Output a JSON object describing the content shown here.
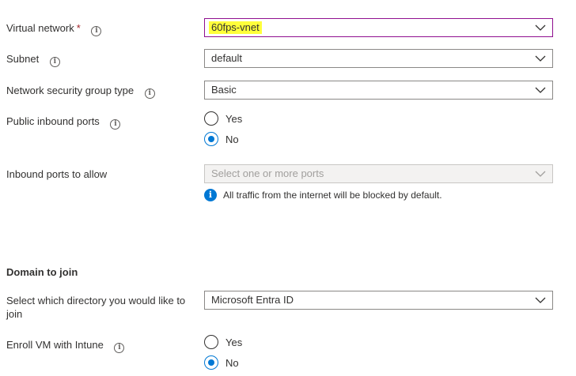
{
  "virtual_network": {
    "label": "Virtual network",
    "required_mark": "*",
    "value": "60fps-vnet"
  },
  "subnet": {
    "label": "Subnet",
    "value": "default"
  },
  "nsg_type": {
    "label": "Network security group type",
    "value": "Basic"
  },
  "public_inbound_ports": {
    "label": "Public inbound ports",
    "options": [
      {
        "label": "Yes",
        "selected": false
      },
      {
        "label": "No",
        "selected": true
      }
    ]
  },
  "inbound_ports": {
    "label": "Inbound ports to allow",
    "placeholder": "Select one or more ports",
    "notice": "All traffic from the internet will be blocked by default."
  },
  "domain_section": {
    "title": "Domain to join"
  },
  "directory": {
    "label": "Select which directory you would like to join",
    "value": "Microsoft Entra ID"
  },
  "enroll_intune": {
    "label": "Enroll VM with Intune",
    "options": [
      {
        "label": "Yes",
        "selected": false
      },
      {
        "label": "No",
        "selected": true
      }
    ]
  },
  "icons": {
    "info": "info-circle-icon",
    "chevron": "chevron-down-icon",
    "notice": "info-filled-icon"
  },
  "colors": {
    "accent": "#0078d4",
    "focus_border": "#8f0f8f",
    "highlight": "#ffff3b",
    "required": "#a4262c"
  }
}
